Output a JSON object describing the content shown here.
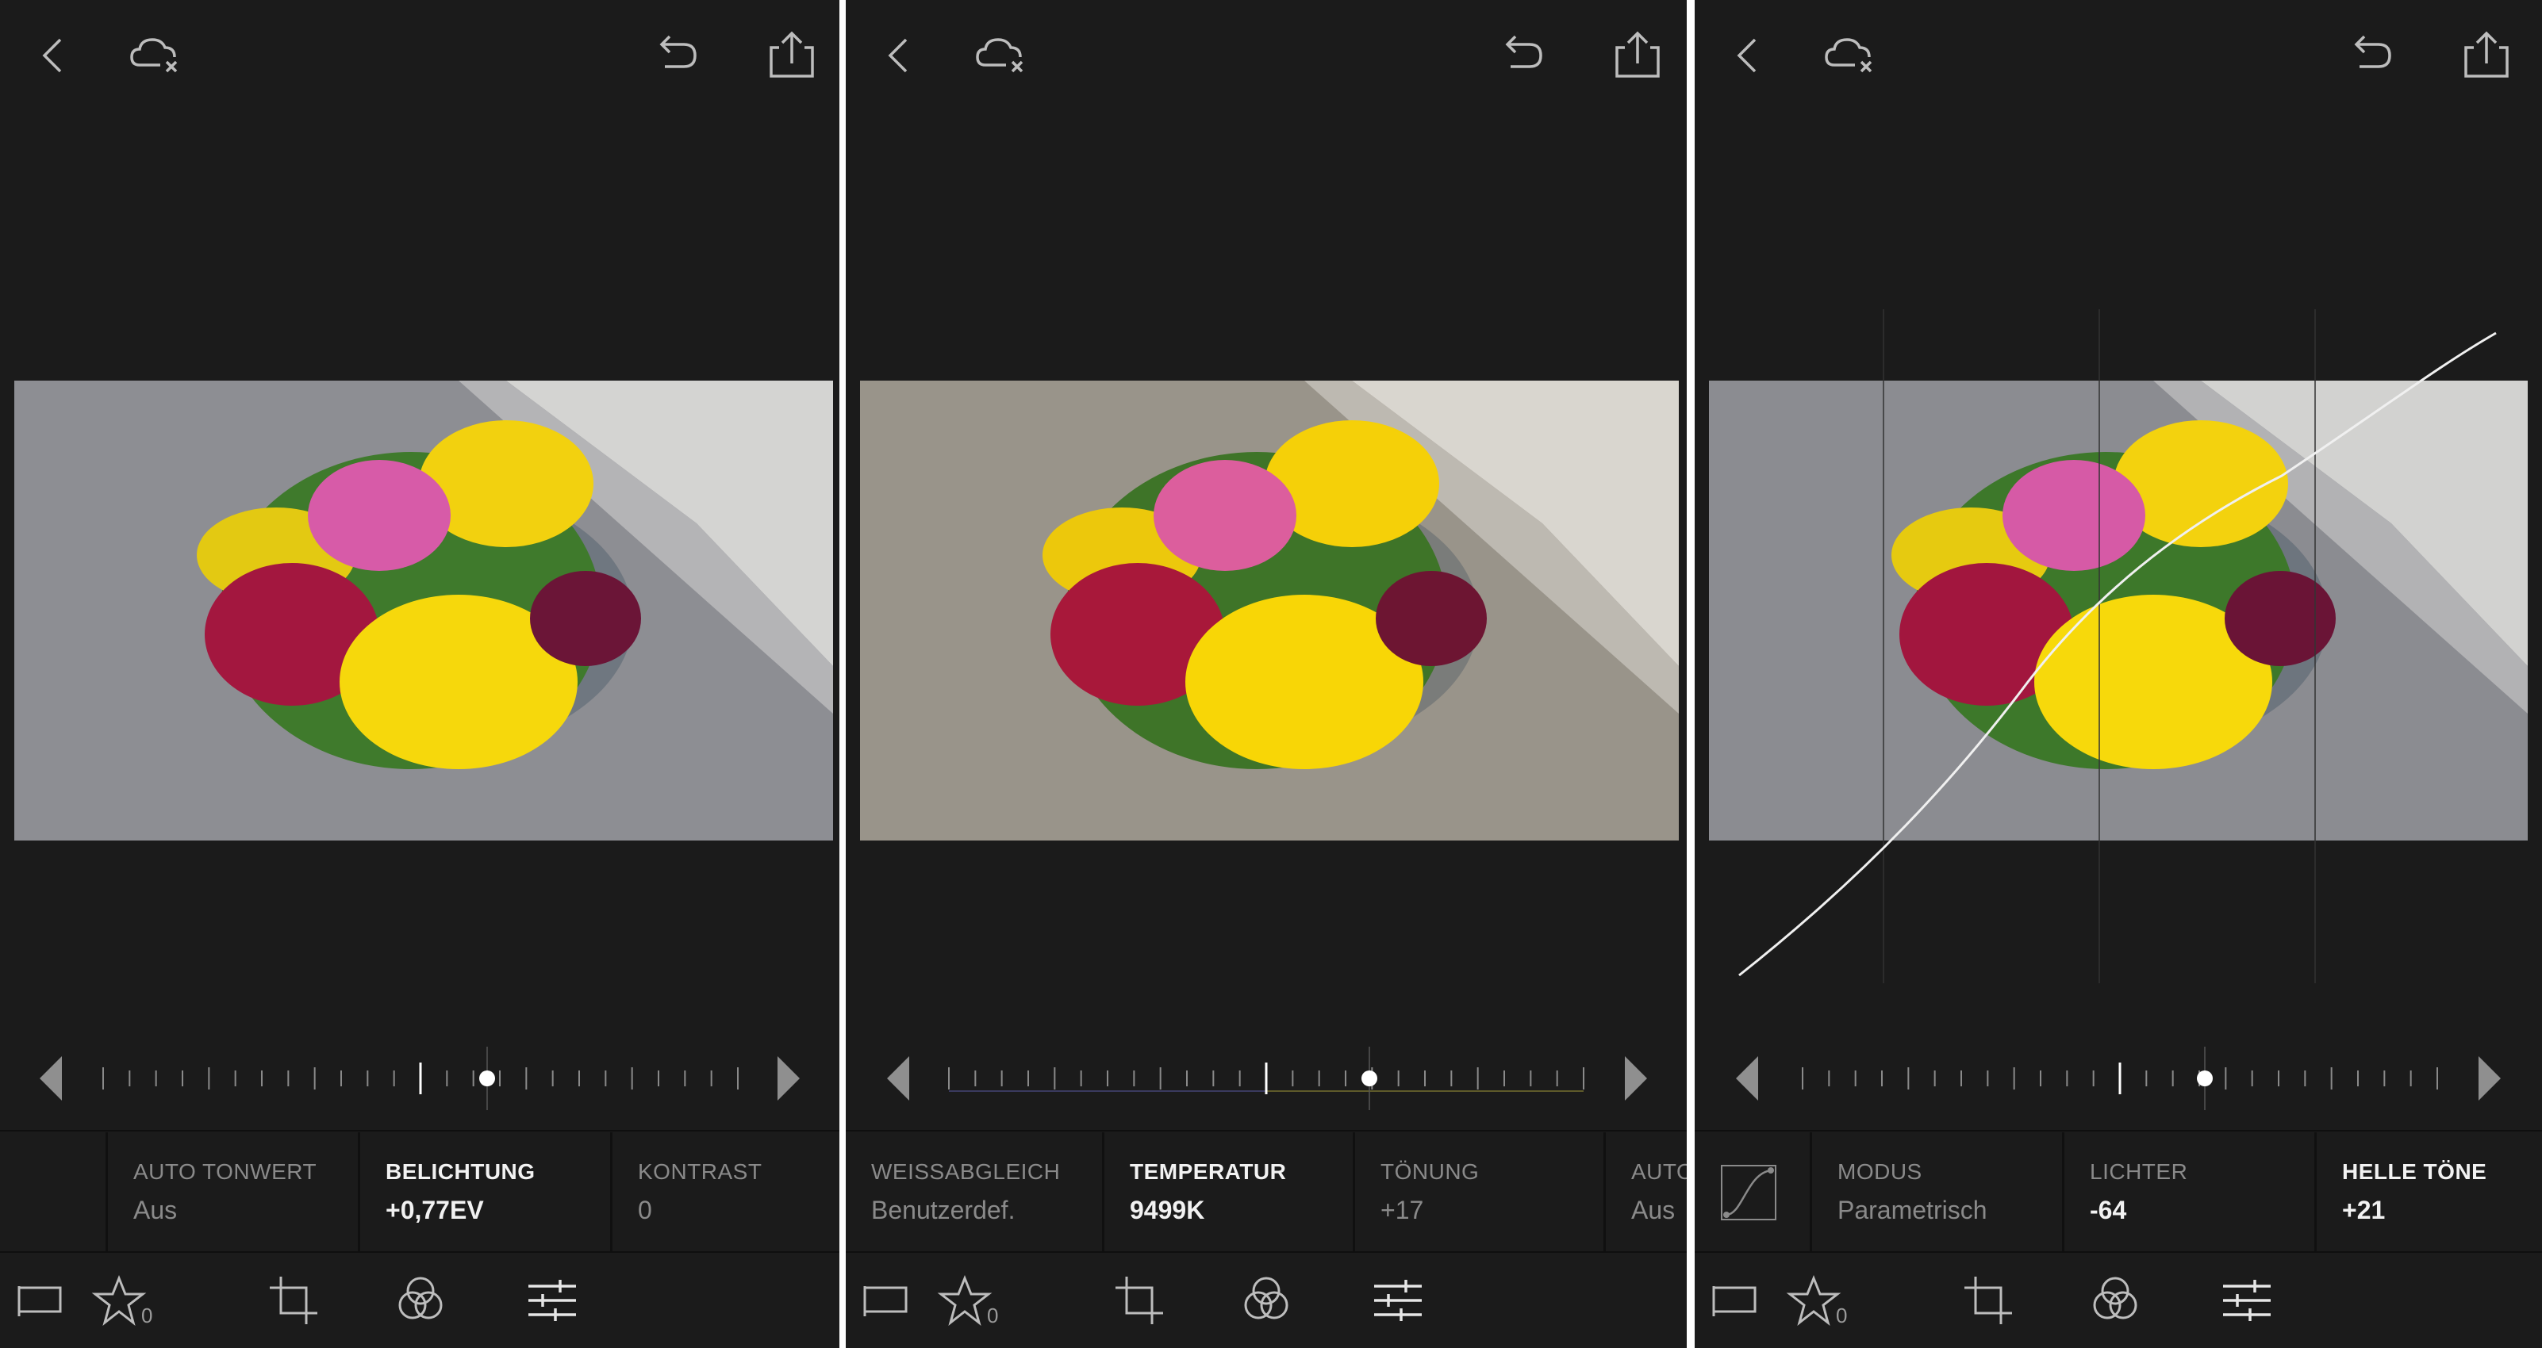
{
  "panels": [
    {
      "slider": {
        "positions": [
          {
            "value": 0.59
          }
        ]
      },
      "tabs": [
        {
          "label": "AUTO TONWERT",
          "value": "Aus",
          "active": false
        },
        {
          "label": "BELICHTUNG",
          "value": "+0,77EV",
          "active": true
        },
        {
          "label": "KONTRAST",
          "value": "0",
          "active": false
        }
      ],
      "rating": "0"
    },
    {
      "slider": {
        "positions": [
          {
            "value": 0.66
          }
        ]
      },
      "tabs": [
        {
          "label": "WEISSABGLEICH",
          "value": "Benutzerdef.",
          "active": false
        },
        {
          "label": "TEMPERATUR",
          "value": "9499K",
          "active": true
        },
        {
          "label": "TÖNUNG",
          "value": "+17",
          "active": false
        },
        {
          "label": "AUTO",
          "value": "Aus",
          "active": false
        }
      ],
      "rating": "0"
    },
    {
      "slider": {
        "positions": [
          {
            "value": 0.61
          }
        ]
      },
      "tabs": [
        {
          "label": "MODUS",
          "value": "Parametrisch",
          "active": false
        },
        {
          "label": "LICHTER",
          "value": "-64",
          "active": false
        },
        {
          "label": "HELLE TÖNE",
          "value": "+21",
          "active": true
        }
      ],
      "rating": "0"
    }
  ],
  "icons": {
    "header": [
      "back-icon",
      "cloud-offline-icon",
      "undo-icon",
      "share-icon"
    ],
    "toolbar": [
      "flag-icon",
      "star-icon",
      "crop-icon",
      "presets-icon",
      "adjustments-icon"
    ],
    "tab_extra": "tone-curve-icon"
  },
  "colors": {
    "background": "#1b1b1b",
    "divider": "#ffffff",
    "active_text": "#f2f2f2",
    "inactive_text": "#8a8a8a"
  }
}
